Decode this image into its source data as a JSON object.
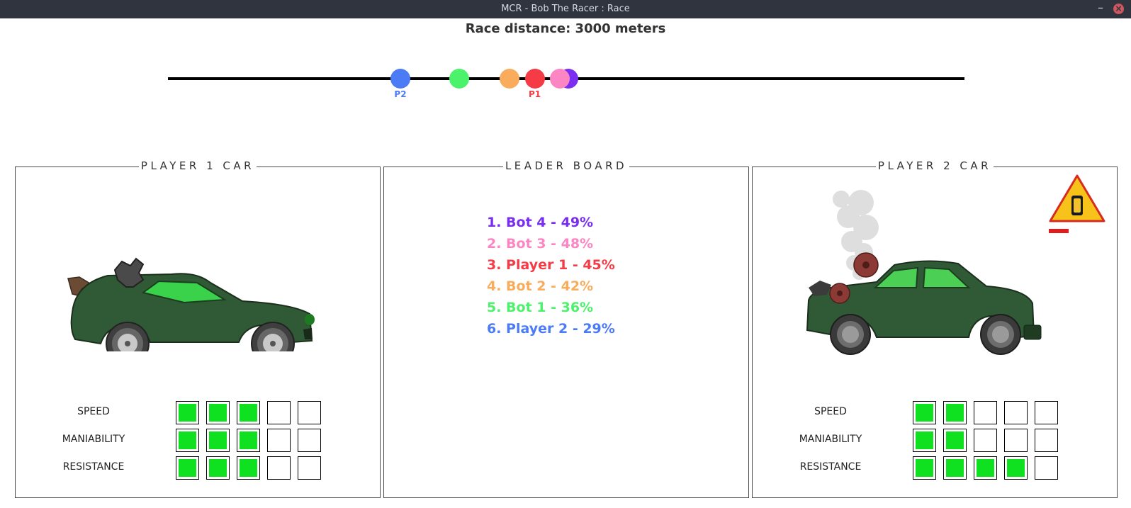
{
  "window": {
    "title": "MCR - Bob The Racer : Race",
    "minimize_glyph": "–",
    "close_glyph": "×"
  },
  "race": {
    "distance_text": "Race distance: 3000 meters",
    "track_markers": [
      {
        "id": "player2",
        "label": "P2",
        "color": "#4b7bf5",
        "progress_pct": 29
      },
      {
        "id": "bot1",
        "label": "",
        "color": "#4df26b",
        "progress_pct": 36
      },
      {
        "id": "bot2",
        "label": "",
        "color": "#f9ad5c",
        "progress_pct": 42
      },
      {
        "id": "player1",
        "label": "P1",
        "color": "#f53b45",
        "progress_pct": 45
      },
      {
        "id": "bot4",
        "label": "",
        "color": "#7a2ef2",
        "progress_pct": 49
      },
      {
        "id": "bot3",
        "label": "",
        "color": "#fb86c3",
        "progress_pct": 48
      }
    ]
  },
  "player1": {
    "title": "PLAYER 1   CAR",
    "stats": [
      {
        "label": "SPEED",
        "level": 3,
        "max": 5
      },
      {
        "label": "MANIABILITY",
        "level": 3,
        "max": 5
      },
      {
        "label": "RESISTANCE",
        "level": 3,
        "max": 5
      }
    ]
  },
  "leaderboard": {
    "title": "LEADER BOARD",
    "entries": [
      {
        "text": "1. Bot 4 - 49%",
        "color": "#7a2ef2"
      },
      {
        "text": "2. Bot 3 - 48%",
        "color": "#fb86c3"
      },
      {
        "text": "3. Player 1 - 45%",
        "color": "#f53b45"
      },
      {
        "text": "4. Bot 2 - 42%",
        "color": "#f9ad5c"
      },
      {
        "text": "5. Bot 1 - 36%",
        "color": "#4df26b"
      },
      {
        "text": "6. Player 2 - 29%",
        "color": "#4b7bf5"
      }
    ]
  },
  "player2": {
    "title": "PLAYER 2   CAR",
    "warning_icon": "car-damage-warning-icon",
    "damage_level": 0.1,
    "stats": [
      {
        "label": "SPEED",
        "level": 2,
        "max": 5
      },
      {
        "label": "MANIABILITY",
        "level": 2,
        "max": 5
      },
      {
        "label": "RESISTANCE",
        "level": 4,
        "max": 5
      }
    ]
  },
  "colors": {
    "stat_on": "#0fe01f",
    "car_body": "#2f5a35",
    "window": "#3ad14b"
  }
}
